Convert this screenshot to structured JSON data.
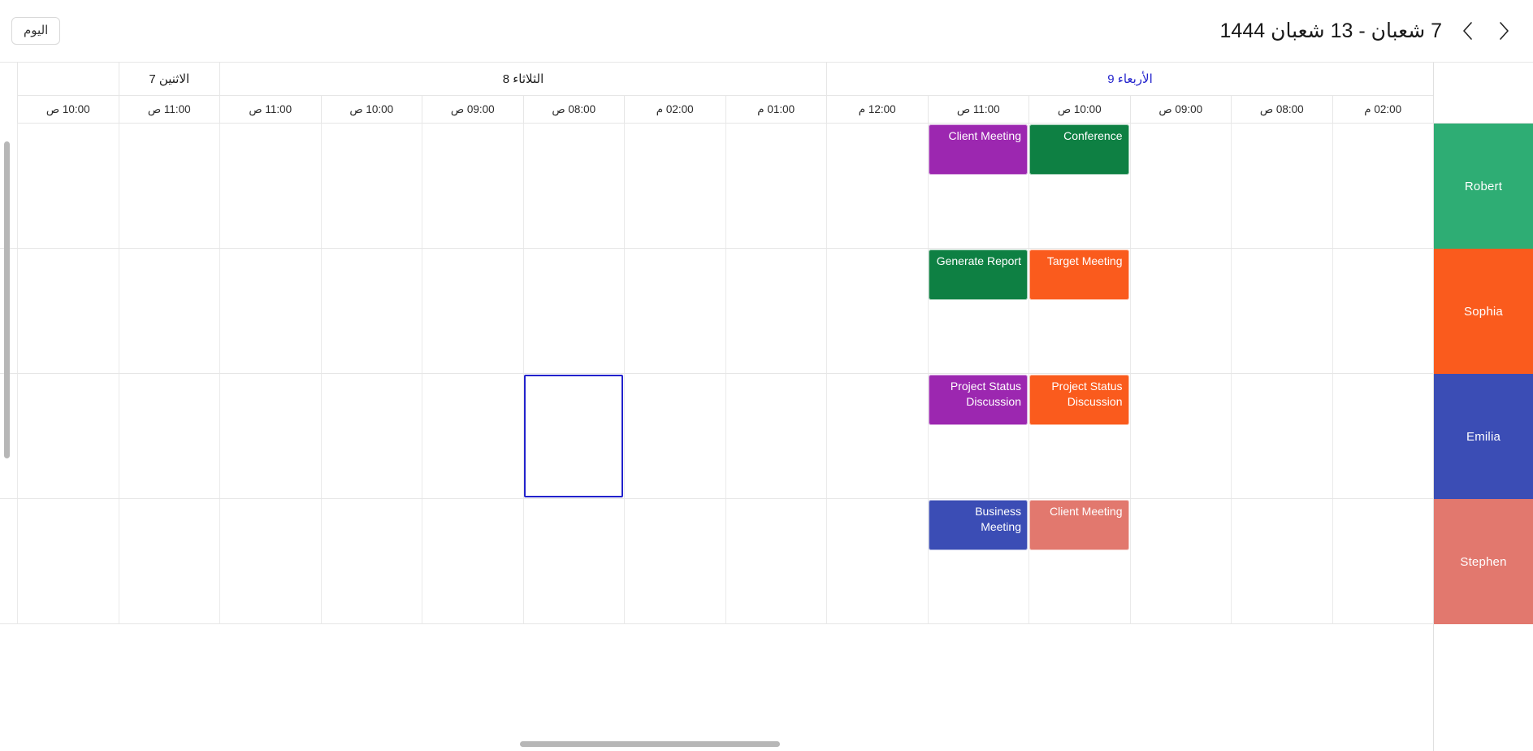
{
  "toolbar": {
    "today_label": "اليوم",
    "title": "7 شعبان - 13 شعبان 1444",
    "prev_icon": "chevron-right-icon",
    "next_icon": "chevron-left-icon"
  },
  "scheduler": {
    "days": [
      {
        "label": "الأربعاء 9",
        "today": true,
        "slots": 6
      },
      {
        "label": "الثلاثاء 8",
        "today": false,
        "slots": 6
      },
      {
        "label": "الاثنين 7",
        "today": false,
        "slots": 1
      },
      {
        "label": "",
        "today": false,
        "slots": 1
      }
    ],
    "times": [
      "02:00 م",
      "08:00 ص",
      "09:00 ص",
      "10:00 ص",
      "11:00 ص",
      "12:00 م",
      "01:00 م",
      "02:00 م",
      "08:00 ص",
      "09:00 ص",
      "10:00 ص",
      "11:00 ص",
      "11:00 ص",
      "10:00 ص"
    ],
    "resources": [
      {
        "name": "Robert",
        "color": "#2EAD74"
      },
      {
        "name": "Sophia",
        "color": "#FA5B1D"
      },
      {
        "name": "Emilia",
        "color": "#3B4DB5"
      },
      {
        "name": "Stephen",
        "color": "#E2786E"
      }
    ],
    "events": [
      {
        "title": "Client Meeting",
        "resource": 0,
        "col": 4,
        "color": "#9C27B0"
      },
      {
        "title": "Conference",
        "resource": 0,
        "col": 3,
        "color": "#0E8043"
      },
      {
        "title": "Generate Report",
        "resource": 1,
        "col": 4,
        "color": "#0E8043"
      },
      {
        "title": "Target Meeting",
        "resource": 1,
        "col": 3,
        "color": "#FA5B1D"
      },
      {
        "title": "Project Status Discussion",
        "resource": 2,
        "col": 4,
        "color": "#9C27B0"
      },
      {
        "title": "Project Status Discussion",
        "resource": 2,
        "col": 3,
        "color": "#FA5B1D"
      },
      {
        "title": "Business Meeting",
        "resource": 3,
        "col": 4,
        "color": "#3B4DB5"
      },
      {
        "title": "Client Meeting",
        "resource": 3,
        "col": 3,
        "color": "#E2786E"
      }
    ],
    "selection": {
      "resource": 2,
      "col": 8
    }
  }
}
